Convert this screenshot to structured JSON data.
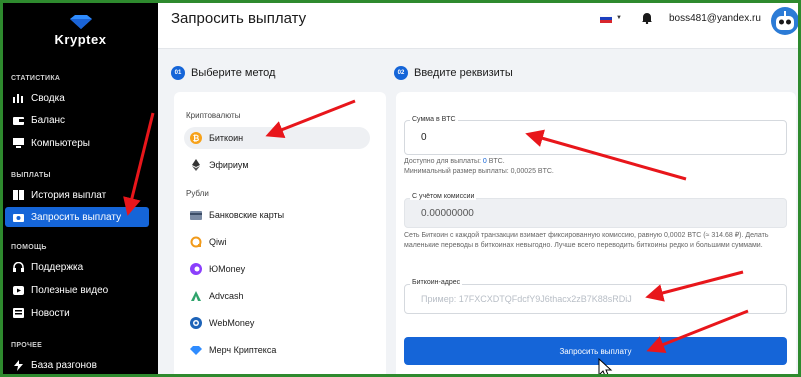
{
  "app": {
    "logo_text": "Kryptex"
  },
  "sidebar": {
    "sections": [
      {
        "title": "СТАТИСТИКА",
        "items": [
          {
            "label": "Сводка",
            "icon": "bar-chart-icon"
          },
          {
            "label": "Баланс",
            "icon": "wallet-icon"
          },
          {
            "label": "Компьютеры",
            "icon": "computer-icon"
          }
        ]
      },
      {
        "title": "ВЫПЛАТЫ",
        "items": [
          {
            "label": "История выплат",
            "icon": "history-icon"
          },
          {
            "label": "Запросить выплату",
            "icon": "payout-icon",
            "active": true
          }
        ]
      },
      {
        "title": "ПОМОЩЬ",
        "items": [
          {
            "label": "Поддержка",
            "icon": "headset-icon"
          },
          {
            "label": "Полезные видео",
            "icon": "youtube-icon"
          },
          {
            "label": "Новости",
            "icon": "news-icon"
          }
        ]
      },
      {
        "title": "ПРОЧЕЕ",
        "items": [
          {
            "label": "База разгонов",
            "icon": "bolt-icon"
          }
        ]
      }
    ]
  },
  "header": {
    "title": "Запросить выплату",
    "language": "ru",
    "email": "boss481@yandex.ru"
  },
  "steps": {
    "step1": {
      "num": "01",
      "label": "Выберите метод"
    },
    "step2": {
      "num": "02",
      "label": "Введите реквизиты"
    }
  },
  "methods": {
    "crypto_title": "Криптовалюты",
    "crypto": [
      {
        "label": "Биткоин",
        "icon": "bitcoin-icon",
        "selected": true
      },
      {
        "label": "Эфириум",
        "icon": "ethereum-icon"
      }
    ],
    "rub_title": "Рубли",
    "rub": [
      {
        "label": "Банковские карты",
        "icon": "bank-card-icon"
      },
      {
        "label": "Qiwi",
        "icon": "qiwi-icon"
      },
      {
        "label": "ЮMoney",
        "icon": "yumoney-icon"
      },
      {
        "label": "Advcash",
        "icon": "advcash-icon"
      },
      {
        "label": "WebMoney",
        "icon": "webmoney-icon"
      },
      {
        "label": "Мерч Криптекса",
        "icon": "merch-icon"
      }
    ]
  },
  "form": {
    "amount_label": "Сумма в BTC",
    "amount_value": "0",
    "available_prefix": "Доступно для выплаты: ",
    "available_value": "0",
    "available_suffix": " BTC.",
    "min_size": "Минимальный размер выплаты: 0,00025 BTC.",
    "commission_label": "С учётом комиссии",
    "commission_value": "0.00000000",
    "network_note": "Сеть Биткоин с каждой транзакции взимает фиксированную комиссию, равную 0,0002 BTC (≈ 314.68 ₽). Делать маленькие переводы в биткоинах невыгодно. Лучше всего переводить биткоины редко и большими суммами.",
    "address_label": "Биткоин-адрес",
    "address_placeholder": "Пример: 17FXCXDTQFdcfY9J6thacx2zB7K88sRDiJ",
    "submit_label": "Запросить выплату"
  },
  "colors": {
    "accent": "#1565d8",
    "sidebar_bg": "#000000",
    "annotation": "#e8161b",
    "frame": "#2e8a2e"
  }
}
